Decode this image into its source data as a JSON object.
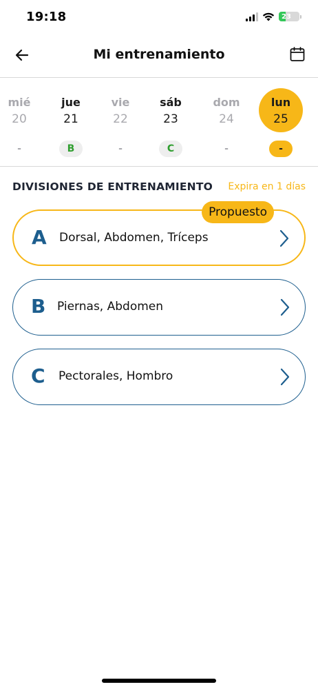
{
  "status_bar": {
    "time": "19:18",
    "battery": "23"
  },
  "header": {
    "title": "Mi entrenamiento",
    "back_icon": "arrow-left-icon",
    "calendar_icon": "calendar-icon"
  },
  "days": [
    {
      "name": "mié",
      "number": "20",
      "tag": "-",
      "state": "muted"
    },
    {
      "name": "jue",
      "number": "21",
      "tag": "B",
      "state": "active"
    },
    {
      "name": "vie",
      "number": "22",
      "tag": "-",
      "state": "muted"
    },
    {
      "name": "sáb",
      "number": "23",
      "tag": "C",
      "state": "active"
    },
    {
      "name": "dom",
      "number": "24",
      "tag": "-",
      "state": "muted"
    },
    {
      "name": "lun",
      "number": "25",
      "tag": "-",
      "state": "selected"
    }
  ],
  "section": {
    "title": "DIVISIONES DE ENTRENAMIENTO",
    "expiry": "Expira en 1 días"
  },
  "divisions": [
    {
      "letter": "A",
      "label": "Dorsal, Abdomen, Tríceps",
      "badge": "Propuesto"
    },
    {
      "letter": "B",
      "label": "Piernas, Abdomen"
    },
    {
      "letter": "C",
      "label": "Pectorales, Hombro"
    }
  ],
  "colors": {
    "accent": "#f7b718",
    "primary": "#1d5e8e",
    "success": "#2f9e2f",
    "muted": "#a9a9ae"
  }
}
